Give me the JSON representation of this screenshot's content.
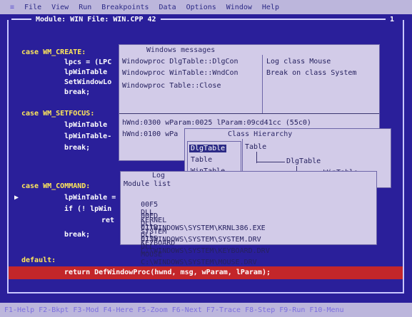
{
  "menubar": {
    "system_glyph": "≡",
    "items": [
      "File",
      "View",
      "Run",
      "Breakpoints",
      "Data",
      "Options",
      "Window",
      "Help"
    ]
  },
  "module_title": {
    "text": "Module: WIN  File: WIN.CPP 42",
    "window_number": "1"
  },
  "code": {
    "case_create": "case WM_CREATE:",
    "l_lpcs": "lpcs = (LPC",
    "l_lpwintable": "lpWinTable",
    "l_setwindowlo": "SetWindowLo",
    "l_break1": "break;",
    "case_setfocus": "case WM_SETFOCUS:",
    "l_lpwintable2": "lpWinTable",
    "l_lpwintable3": "lpWinTable-",
    "l_break2": "break;",
    "case_command": "case WM_COMMAND:",
    "l_lpwintable4": "lpWinTable =",
    "l_if": "if (! lpWin",
    "l_ret": "ret",
    "l_break3": "break;",
    "l_default": "default:",
    "l_return": "return DefWindowProc(hwnd, msg, wParam, lParam);"
  },
  "windows_messages": {
    "title": "Windows messages",
    "left": [
      "Windowproc DlgTable::DlgCon",
      "Windowproc WinTable::WndCon",
      "Windowproc Table::Close"
    ],
    "right": [
      "Log class Mouse",
      "Break on class System"
    ],
    "bottom": [
      "hWnd:0300 wParam:0025 lParam:09cd41cc (55c0)",
      "hWnd:0100 wPa"
    ],
    "right_bottom": [
      "Class Hierarchy"
    ]
  },
  "hierarchy": {
    "items": [
      "DlgTable",
      "Table",
      "WinTable"
    ],
    "selected": "DlgTable",
    "tree": [
      "Table",
      "DlgTable",
      "WinTable"
    ]
  },
  "log": {
    "title": "Log",
    "header": "Module list",
    "rows": [
      [
        "00F5",
        "DLL",
        "KERNEL",
        "C:\\WINDOWS\\SYSTEM\\KRNL386.EXE"
      ],
      [
        "00ED",
        "DLL",
        "SYSTEM",
        "C:\\WINDOWS\\SYSTEM\\SYSTEM.DRV"
      ],
      [
        "011D",
        "DLL",
        "KEYBOARD",
        "C:\\WINDOWS\\SYSTEM\\KEYBOARD.DRV"
      ],
      [
        "0135",
        "DLL",
        "MOUSE",
        "C:\\WINDOWS\\SYSTEM\\MOUSE.DRV"
      ]
    ]
  },
  "statusbar": [
    "F1-Help",
    "F2-Bkpt",
    "F3-Mod",
    "F4-Here",
    "F5-Zoom",
    "F6-Next",
    "F7-Trace",
    "F8-Step",
    "F9-Run",
    "F10-Menu"
  ]
}
